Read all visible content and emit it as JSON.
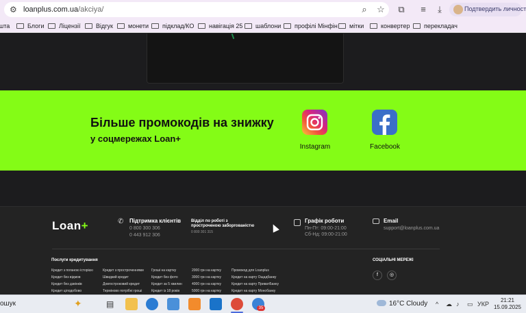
{
  "browser": {
    "url_host": "loanplus.com.ua",
    "url_path": "/akciya/",
    "profile_label": "Подтвердить личность"
  },
  "bookmarks": [
    "шта",
    "Блоги",
    "Ліцензії",
    "Відгук",
    "монети",
    "підклад/КО",
    "навігація 25",
    "шаблони",
    "профілі Мінфін",
    "мітки",
    "конвертер",
    "перекладач"
  ],
  "promo": {
    "title": "Більше промокодів на знижку",
    "subtitle": "у соцмережах Loan+",
    "instagram_label": "Instagram",
    "facebook_label": "Facebook",
    "accent_color": "#84fc16"
  },
  "footer": {
    "logo_text": "Loan",
    "logo_plus": "+",
    "support": {
      "title": "Підтримка клієнтів",
      "phone1": "0 800 300 306",
      "phone2": "0 443 912 306"
    },
    "overdue": {
      "title": "Відділ по роботі з простроченою заборгованістю",
      "phone": "0 800 301 315"
    },
    "schedule": {
      "title": "Графік роботи",
      "weekdays": "Пн-Пт: 09:00-21:00",
      "weekend": "Сб-Нд: 09:00-21:00"
    },
    "email": {
      "title": "Email",
      "address": "support@loanplus.com.ua"
    },
    "services_title": "Послуги кредитування",
    "services": [
      [
        "Кредит з поганою історією",
        "Кредит без відмов",
        "Кредит без дзвінків",
        "Кредит цілодобово"
      ],
      [
        "Кредит з простроченнями",
        "Швидкий кредит",
        "Довгостроковий кредит",
        "Терміново потрібні гроші"
      ],
      [
        "Гроші на картку",
        "Кредит без фото",
        "Кредит за 5 хвилин",
        "Кредит із 18 років"
      ],
      [
        "2000 грн на картку",
        "3000 грн на картку",
        "4000 грн на картку",
        "5000 грн на картку"
      ],
      [
        "Промокод для Loanplus",
        "Кредит на карту Ощадбанку",
        "Кредит на карту ПриватБанку",
        "Кредит на карту Монобанку"
      ]
    ],
    "social_title": "СОЦІАЛЬНІ МЕРЕЖІ"
  },
  "taskbar": {
    "search_fragment": "ошук",
    "weather_temp": "16°C",
    "weather_text": "Cloudy",
    "lang": "УКР",
    "time": "21:21",
    "date": "15.09.2025",
    "badge": "35"
  }
}
